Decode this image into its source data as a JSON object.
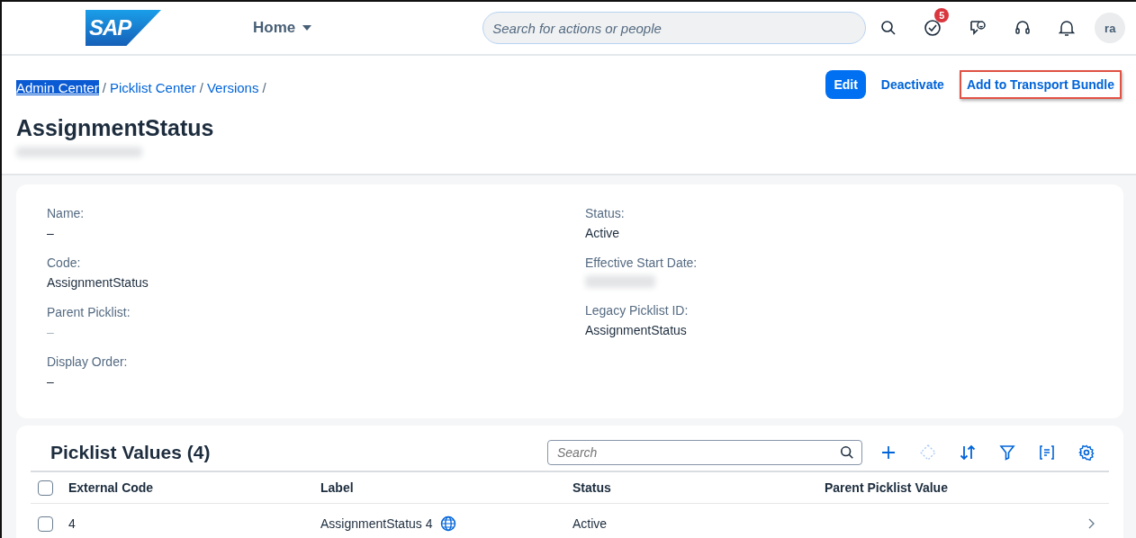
{
  "shell": {
    "logo": "SAP",
    "home": "Home",
    "search": {
      "placeholder": "Search for actions or people"
    },
    "todo_badge": "5",
    "avatar": "ra"
  },
  "breadcrumb": [
    {
      "label": "Admin Center",
      "highlighted": true,
      "separator": "/"
    },
    {
      "label": "Picklist Center",
      "highlighted": false,
      "separator": "/"
    },
    {
      "label": "Versions",
      "highlighted": false,
      "separator": "/"
    }
  ],
  "actions": [
    {
      "label": "Edit",
      "kind": "emphasized",
      "outlined": false
    },
    {
      "label": "Deactivate",
      "kind": "transparent",
      "outlined": false
    },
    {
      "label": "Add to Transport Bundle",
      "kind": "transparent",
      "outlined": true
    }
  ],
  "title": "AssignmentStatus",
  "details": {
    "left": [
      {
        "label": "Name:",
        "value": "–"
      },
      {
        "label": "Code:",
        "value": "AssignmentStatus"
      },
      {
        "label": "Parent Picklist:",
        "value": "–",
        "muted": true
      },
      {
        "label": "Display Order:",
        "value": "–"
      }
    ],
    "right": [
      {
        "label": "Status:",
        "value": "Active"
      },
      {
        "label": "Effective Start Date:",
        "redacted": true
      },
      {
        "label": "Legacy Picklist ID:",
        "value": "AssignmentStatus"
      }
    ]
  },
  "table": {
    "title": "Picklist Values (4)",
    "search": {
      "placeholder": "Search"
    },
    "tools": [
      {
        "kind": "add",
        "disabled": false
      },
      {
        "kind": "diamond",
        "disabled": true
      },
      {
        "kind": "sort",
        "disabled": false
      },
      {
        "kind": "filter",
        "disabled": false
      },
      {
        "kind": "group",
        "disabled": false
      },
      {
        "kind": "settings",
        "disabled": false
      }
    ],
    "columns": [
      "External Code",
      "Label",
      "Status",
      "Parent Picklist Value"
    ],
    "all_checked": false,
    "rows": [
      {
        "checked": false,
        "cells": [
          "4",
          "AssignmentStatus 4",
          "Active",
          null
        ],
        "translated": true
      }
    ]
  }
}
